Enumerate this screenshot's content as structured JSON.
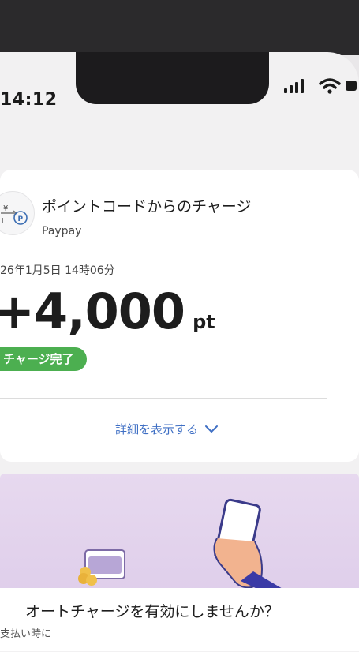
{
  "status_bar": {
    "time": "14:12",
    "icons": [
      "signal-icon",
      "wifi-icon",
      "battery-icon"
    ]
  },
  "transaction": {
    "title": "ポイントコードからのチャージ",
    "merchant": "Paypay",
    "datetime": "26年1月5日 14時06分",
    "amount": "+4,000",
    "unit": "pt",
    "status": "チャージ完了",
    "details_link": "詳細を表示する",
    "icon": "point-charge-icon"
  },
  "promo": {
    "title": "オートチャージを有効にしませんか？",
    "subtext": "支払い時に"
  },
  "colors": {
    "status_badge": "#4caf50",
    "link": "#3f6fc4",
    "promo_bg": "#e4d5ee"
  }
}
